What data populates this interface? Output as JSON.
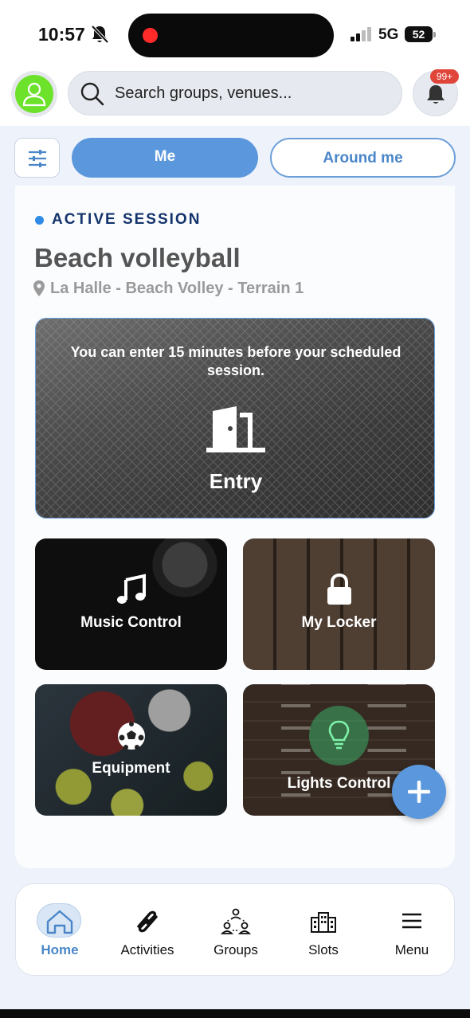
{
  "status_bar": {
    "time": "10:57",
    "network": "5G",
    "battery": "52"
  },
  "header": {
    "search_placeholder": "Search groups, venues...",
    "notification_count": "99+"
  },
  "segments": {
    "me": "Me",
    "around_me": "Around me",
    "selected": "Me"
  },
  "session": {
    "status": "ACTIVE SESSION",
    "title": "Beach volleyball",
    "venue": "La Halle - Beach Volley - Terrain 1",
    "entry_message": "You can enter 15 minutes before your scheduled session.",
    "entry_label": "Entry"
  },
  "tiles": {
    "music": "Music Control",
    "locker": "My Locker",
    "equipment": "Equipment",
    "lights": "Lights Control"
  },
  "tabbar": {
    "items": [
      {
        "label": "Home",
        "icon": "home-icon",
        "active": true
      },
      {
        "label": "Activities",
        "icon": "activities-icon"
      },
      {
        "label": "Groups",
        "icon": "groups-icon"
      },
      {
        "label": "Slots",
        "icon": "slots-icon"
      },
      {
        "label": "Menu",
        "icon": "menu-icon"
      }
    ]
  },
  "colors": {
    "accent": "#5b97dc",
    "active_text": "#12336b",
    "badge": "#e0453a",
    "avatar": "#6de22b"
  }
}
